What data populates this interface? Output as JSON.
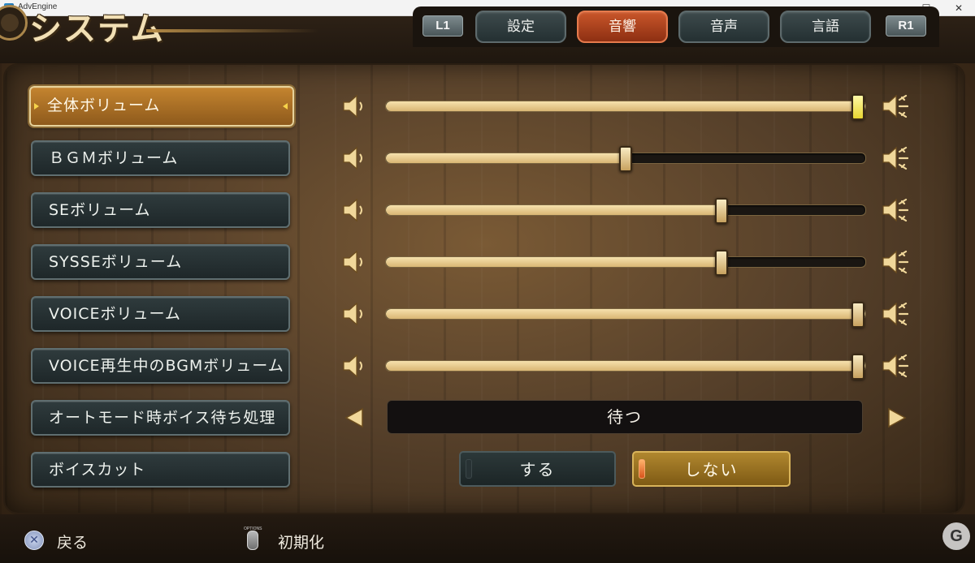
{
  "window": {
    "title": "AdvEngine",
    "minimize": "—",
    "maximize": "☐",
    "close": "✕"
  },
  "header": {
    "title": "システム"
  },
  "tabs": {
    "l1": "L1",
    "r1": "R1",
    "items": [
      {
        "label": "設定",
        "active": false
      },
      {
        "label": "音響",
        "active": true
      },
      {
        "label": "音声",
        "active": false
      },
      {
        "label": "言語",
        "active": false
      }
    ]
  },
  "sliders": [
    {
      "label": "全体ボリューム",
      "value": 1.0,
      "selected": true
    },
    {
      "label": "ＢＧＭボリューム",
      "value": 0.5
    },
    {
      "label": "SEボリューム",
      "value": 0.7
    },
    {
      "label": "SYSSEボリューム",
      "value": 0.7
    },
    {
      "label": "VOICEボリューム",
      "value": 1.0
    },
    {
      "label": "VOICE再生中のBGMボリューム",
      "value": 1.0
    }
  ],
  "auto_mode": {
    "label": "オートモード時ボイス待ち処理",
    "value": "待つ"
  },
  "voice_cut": {
    "label": "ボイスカット",
    "options": [
      "する",
      "しない"
    ],
    "selected": "しない"
  },
  "footer": {
    "back_button": "✕",
    "back_label": "戻る",
    "options_tag": "OPTIONS",
    "reset_label": "初期化",
    "logo": "G"
  },
  "colors": {
    "accent_tab": "#c9562a",
    "selected_row": "#c4842f",
    "slider_fill": "#f6e1ad",
    "knob_highlight": "#e7d531"
  }
}
